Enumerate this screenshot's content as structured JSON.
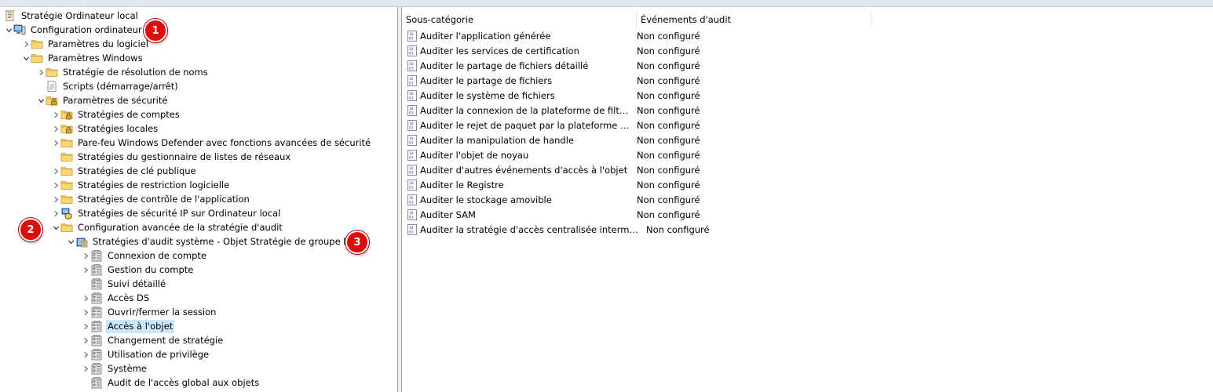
{
  "tree": {
    "root": "Stratégie Ordinateur local",
    "computer_config": "Configuration ordinateur",
    "software_settings": "Paramètres du logiciel",
    "windows_settings": "Paramètres Windows",
    "name_resolution": "Stratégie de résolution de noms",
    "scripts": "Scripts (démarrage/arrêt)",
    "security_settings": "Paramètres de sécurité",
    "account_policies": "Stratégies de comptes",
    "local_policies": "Stratégies locales",
    "firewall": "Pare-feu Windows Defender avec fonctions avancées de sécurité",
    "network_list": "Stratégies du gestionnaire de listes de réseaux",
    "public_key": "Stratégies de clé publique",
    "software_restriction": "Stratégies de restriction logicielle",
    "app_control": "Stratégies de contrôle de l'application",
    "ip_security": "Stratégies de sécurité IP sur Ordinateur local",
    "advanced_audit": "Configuration avancée de la stratégie d'audit",
    "system_audit": "Stratégies d'audit système - Objet Stratégie de groupe local",
    "account_logon": "Connexion de compte",
    "account_management": "Gestion du compte",
    "detailed_tracking": "Suivi détaillé",
    "ds_access": "Accès DS",
    "logon_logoff": "Ouvrir/fermer la session",
    "object_access": "Accès à l'objet",
    "policy_change": "Changement de stratégie",
    "privilege_use": "Utilisation de privilège",
    "system": "Système",
    "global_object_access": "Audit de l'accès global aux objets"
  },
  "list": {
    "col_subcategory": "Sous-catégorie",
    "col_audit_events": "Événements d'audit",
    "rows": [
      {
        "name": "Auditer l'application générée",
        "value": "Non configuré"
      },
      {
        "name": "Auditer les services de certification",
        "value": "Non configuré"
      },
      {
        "name": "Auditer le partage de fichiers détaillé",
        "value": "Non configuré"
      },
      {
        "name": "Auditer le partage de fichiers",
        "value": "Non configuré"
      },
      {
        "name": "Auditer le système de fichiers",
        "value": "Non configuré"
      },
      {
        "name": "Auditer la connexion de la plateforme de filtrage",
        "value": "Non configuré"
      },
      {
        "name": "Auditer le rejet de paquet par la plateforme de filtrage",
        "value": "Non configuré"
      },
      {
        "name": "Auditer la manipulation de handle",
        "value": "Non configuré"
      },
      {
        "name": "Auditer l'objet de noyau",
        "value": "Non configuré"
      },
      {
        "name": "Auditer d'autres événements d'accès à l'objet",
        "value": "Non configuré"
      },
      {
        "name": "Auditer le Registre",
        "value": "Non configuré"
      },
      {
        "name": "Auditer le stockage amovible",
        "value": "Non configuré"
      },
      {
        "name": "Auditer SAM",
        "value": "Non configuré"
      },
      {
        "name": "Auditer la stratégie d'accès centralisée intermédiaire",
        "value": "Non configuré"
      }
    ]
  },
  "badges": [
    "1",
    "2",
    "3"
  ],
  "colors": {
    "selection": "#cce8ff",
    "badge": "#dd0d0d",
    "folder": "#f2c863"
  }
}
